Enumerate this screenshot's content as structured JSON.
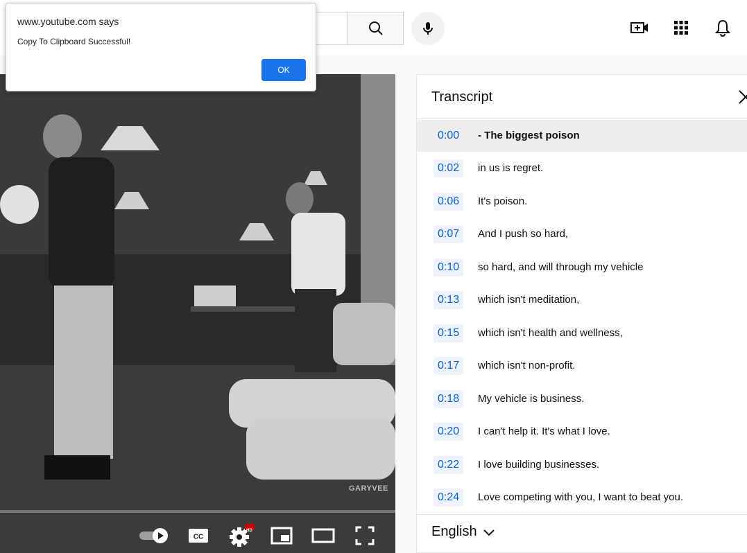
{
  "dialog": {
    "title": "www.youtube.com says",
    "message": "Copy To Clipboard Successful!",
    "ok_label": "OK"
  },
  "header": {
    "icons": [
      "search-icon",
      "microphone-icon",
      "create-video-icon",
      "apps-grid-icon",
      "notifications-bell-icon"
    ]
  },
  "video": {
    "watermark": "GARYVEE",
    "controls": [
      "autoplay-toggle",
      "captions-button",
      "settings-button",
      "miniplayer-button",
      "theater-mode-button",
      "fullscreen-button"
    ],
    "settings_badge": "HD"
  },
  "transcript": {
    "title": "Transcript",
    "language": "English",
    "segments": [
      {
        "time": "0:00",
        "text": "- The biggest poison"
      },
      {
        "time": "0:02",
        "text": "in us is regret."
      },
      {
        "time": "0:06",
        "text": "It's poison."
      },
      {
        "time": "0:07",
        "text": "And I push so hard,"
      },
      {
        "time": "0:10",
        "text": "so hard, and will through my vehicle"
      },
      {
        "time": "0:13",
        "text": "which isn't meditation,"
      },
      {
        "time": "0:15",
        "text": "which isn't health and wellness,"
      },
      {
        "time": "0:17",
        "text": "which isn't non-profit."
      },
      {
        "time": "0:18",
        "text": "My vehicle is business."
      },
      {
        "time": "0:20",
        "text": "I can't help it. It's what I love."
      },
      {
        "time": "0:22",
        "text": "I love building businesses."
      },
      {
        "time": "0:24",
        "text": "Love competing with you, I want to beat you."
      }
    ]
  },
  "colors": {
    "accent": "#065fd4",
    "dialog_button": "#1a73e8",
    "active_segment_bg": "#eeeeee"
  }
}
